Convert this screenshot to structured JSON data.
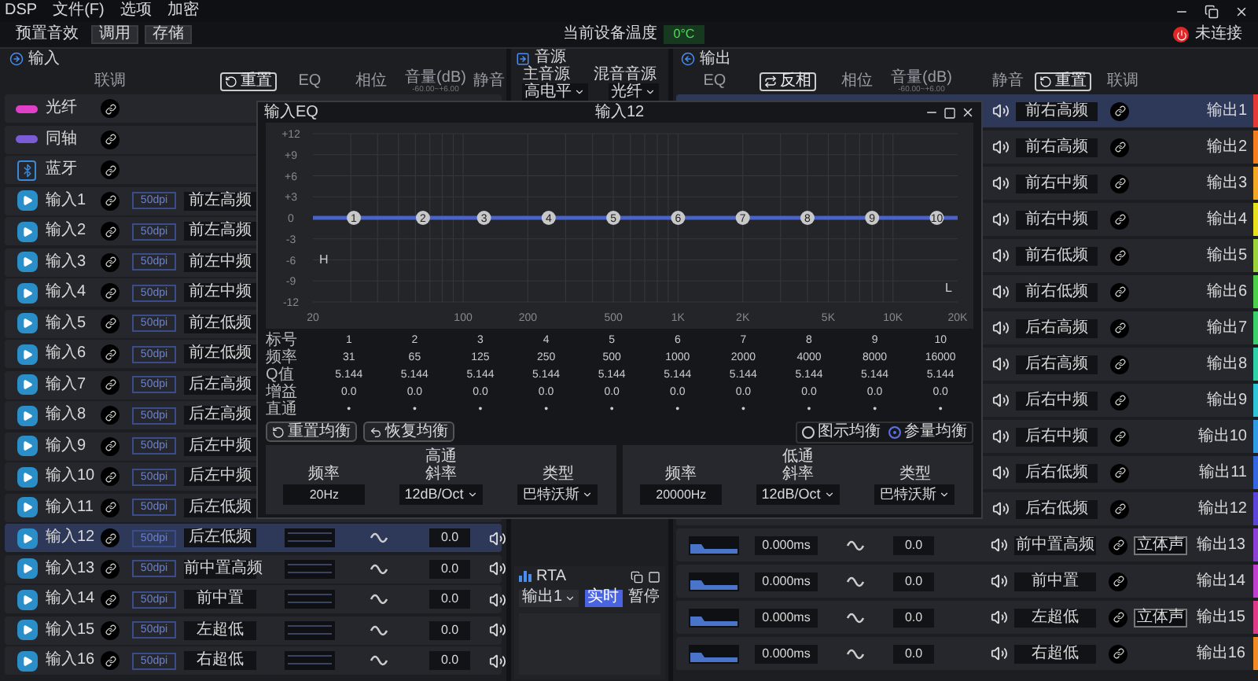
{
  "menu": [
    "DSP",
    "文件(F)",
    "选项",
    "加密"
  ],
  "toolbar": {
    "preset_label": "预置音效",
    "buttons": [
      "调用",
      "存储"
    ],
    "temperature_label": "当前设备温度",
    "temperature": "0°C",
    "connection": "未连接"
  },
  "input_panel": {
    "title": "输入",
    "columns": {
      "link": "联调",
      "reset": "重置",
      "eq": "EQ",
      "phase": "相位",
      "volume": "音量(dB)",
      "volume_range": "-60.00~+6.00",
      "mute": "静音"
    },
    "rows": [
      {
        "kind": "optical",
        "name": "光纤",
        "selected": false
      },
      {
        "kind": "coaxial",
        "name": "同轴",
        "selected": false
      },
      {
        "kind": "bluetooth",
        "name": "蓝牙",
        "selected": false
      },
      {
        "kind": "analog",
        "name": "输入1",
        "rate": "50dpi",
        "source": "前左高频",
        "selected": false
      },
      {
        "kind": "analog",
        "name": "输入2",
        "rate": "50dpi",
        "source": "前左高频",
        "selected": false
      },
      {
        "kind": "analog",
        "name": "输入3",
        "rate": "50dpi",
        "source": "前左中频",
        "selected": false
      },
      {
        "kind": "analog",
        "name": "输入4",
        "rate": "50dpi",
        "source": "前左中频",
        "selected": false
      },
      {
        "kind": "analog",
        "name": "输入5",
        "rate": "50dpi",
        "source": "前左低频",
        "selected": false
      },
      {
        "kind": "analog",
        "name": "输入6",
        "rate": "50dpi",
        "source": "前左低频",
        "selected": false
      },
      {
        "kind": "analog",
        "name": "输入7",
        "rate": "50dpi",
        "source": "后左高频",
        "selected": false
      },
      {
        "kind": "analog",
        "name": "输入8",
        "rate": "50dpi",
        "source": "后左高频",
        "selected": false
      },
      {
        "kind": "analog",
        "name": "输入9",
        "rate": "50dpi",
        "source": "后左中频",
        "selected": false
      },
      {
        "kind": "analog",
        "name": "输入10",
        "rate": "50dpi",
        "source": "后左中频",
        "selected": false
      },
      {
        "kind": "analog",
        "name": "输入11",
        "rate": "50dpi",
        "source": "后左低频",
        "selected": false
      },
      {
        "kind": "analog",
        "name": "输入12",
        "rate": "50dpi",
        "source": "后左低频",
        "volume": "0.0",
        "selected": true
      },
      {
        "kind": "analog",
        "name": "输入13",
        "rate": "50dpi",
        "source": "前中置高频",
        "volume": "0.0",
        "selected": false
      },
      {
        "kind": "analog",
        "name": "输入14",
        "rate": "50dpi",
        "source": "前中置",
        "volume": "0.0",
        "selected": false
      },
      {
        "kind": "analog",
        "name": "输入15",
        "rate": "50dpi",
        "source": "左超低",
        "volume": "0.0",
        "selected": false
      },
      {
        "kind": "analog",
        "name": "输入16",
        "rate": "50dpi",
        "source": "右超低",
        "volume": "0.0",
        "selected": false
      }
    ]
  },
  "source_panel": {
    "title": "音源",
    "main_label": "主音源",
    "mix_label": "混音音源",
    "main_value": "高电平",
    "mix_value": "光纤"
  },
  "rta": {
    "title": "RTA",
    "channel": "输出1",
    "modes": [
      {
        "label": "实时",
        "selected": true
      },
      {
        "label": "暂停",
        "selected": false
      }
    ]
  },
  "output_panel": {
    "title": "输出",
    "columns": {
      "eq": "EQ",
      "invert": "反相",
      "phase": "相位",
      "volume": "音量(dB)",
      "volume_range": "-60.00~+6.00",
      "mute": "静音",
      "reset": "重置",
      "link": "联调"
    },
    "rows": [
      {
        "name": "输出1",
        "source": "前右高频",
        "color": "#e53935",
        "selected": true
      },
      {
        "name": "输出2",
        "source": "前右高频",
        "color": "#f57c1f",
        "selected": false
      },
      {
        "name": "输出3",
        "source": "前右中频",
        "color": "#f5a623",
        "selected": false
      },
      {
        "name": "输出4",
        "source": "前右中频",
        "color": "#e6e01f",
        "selected": false
      },
      {
        "name": "输出5",
        "source": "前右低频",
        "color": "#9ad43a",
        "selected": false
      },
      {
        "name": "输出6",
        "source": "前右低频",
        "color": "#4cd04a",
        "selected": false
      },
      {
        "name": "输出7",
        "source": "后右高频",
        "color": "#3ccf6e",
        "selected": false
      },
      {
        "name": "输出8",
        "source": "后右高频",
        "color": "#2fd1a8",
        "selected": false
      },
      {
        "name": "输出9",
        "source": "后右中频",
        "color": "#2ec5d9",
        "selected": false
      },
      {
        "name": "输出10",
        "source": "后右中频",
        "color": "#2f9be6",
        "selected": false
      },
      {
        "name": "输出11",
        "source": "后右低频",
        "color": "#3366e0",
        "selected": false
      },
      {
        "name": "输出12",
        "source": "后右低频",
        "color": "#5a45d8",
        "selected": false
      },
      {
        "name": "输出13",
        "source": "前中置高频",
        "color": "#8a3fd6",
        "selected": false,
        "delay": "0.000ms",
        "volume": "0.0",
        "badge": "立体声"
      },
      {
        "name": "输出14",
        "source": "前中置",
        "color": "#c03fd0",
        "selected": false,
        "delay": "0.000ms",
        "volume": "0.0"
      },
      {
        "name": "输出15",
        "source": "左超低",
        "color": "#e03a8a",
        "selected": false,
        "delay": "0.000ms",
        "volume": "0.0",
        "badge": "立体声"
      },
      {
        "name": "输出16",
        "source": "右超低",
        "color": "#f08a24",
        "selected": false,
        "delay": "0.000ms",
        "volume": "0.0"
      }
    ]
  },
  "eq_dialog": {
    "title": "输入EQ",
    "channel": "输入12",
    "point_labels": [
      "1",
      "2",
      "3",
      "4",
      "5",
      "6",
      "7",
      "8",
      "9",
      "10"
    ],
    "gain_axis": [
      "+12",
      "+9",
      "+6",
      "+3",
      "0",
      "-3",
      "-6",
      "-9",
      "-12"
    ],
    "frequency_axis": [
      "20",
      "100",
      "200",
      "500",
      "1K",
      "2K",
      "5K",
      "10K",
      "20K"
    ],
    "hp_marker": "H",
    "lp_marker": "L",
    "table_headers": [
      "标号",
      "频率",
      "Q值",
      "增益",
      "直通"
    ],
    "bands": [
      {
        "number": "1",
        "freq": "31",
        "q": "5.144",
        "gain": "0.0",
        "bypass": "•"
      },
      {
        "number": "2",
        "freq": "65",
        "q": "5.144",
        "gain": "0.0",
        "bypass": "•"
      },
      {
        "number": "3",
        "freq": "125",
        "q": "5.144",
        "gain": "0.0",
        "bypass": "•"
      },
      {
        "number": "4",
        "freq": "250",
        "q": "5.144",
        "gain": "0.0",
        "bypass": "•"
      },
      {
        "number": "5",
        "freq": "500",
        "q": "5.144",
        "gain": "0.0",
        "bypass": "•"
      },
      {
        "number": "6",
        "freq": "1000",
        "q": "5.144",
        "gain": "0.0",
        "bypass": "•"
      },
      {
        "number": "7",
        "freq": "2000",
        "q": "5.144",
        "gain": "0.0",
        "bypass": "•"
      },
      {
        "number": "8",
        "freq": "4000",
        "q": "5.144",
        "gain": "0.0",
        "bypass": "•"
      },
      {
        "number": "9",
        "freq": "8000",
        "q": "5.144",
        "gain": "0.0",
        "bypass": "•"
      },
      {
        "number": "10",
        "freq": "16000",
        "q": "5.144",
        "gain": "0.0",
        "bypass": "•"
      }
    ],
    "buttons": [
      {
        "kind": "reset",
        "label": "重置均衡"
      },
      {
        "kind": "restore",
        "label": "恢复均衡"
      }
    ],
    "modes": [
      {
        "label": "图示均衡",
        "selected": false
      },
      {
        "label": "参量均衡",
        "selected": true
      }
    ],
    "filters": [
      {
        "title": "高通",
        "freq_label": "频率",
        "slope_label": "斜率",
        "type_label": "类型",
        "freq": "20Hz",
        "slope": "12dB/Oct",
        "type": "巴特沃斯"
      },
      {
        "title": "低通",
        "freq_label": "频率",
        "slope_label": "斜率",
        "type_label": "类型",
        "freq": "20000Hz",
        "slope": "12dB/Oct",
        "type": "巴特沃斯"
      }
    ]
  }
}
